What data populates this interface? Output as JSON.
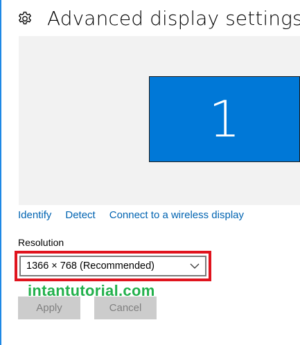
{
  "header": {
    "title": "Advanced display settings",
    "icon": "gear-icon"
  },
  "preview": {
    "monitor_number": "1",
    "monitor_color": "#0078d7"
  },
  "links": {
    "identify": "Identify",
    "detect": "Detect",
    "connect_wireless": "Connect to a wireless display"
  },
  "resolution": {
    "label": "Resolution",
    "selected": "1366 × 768 (Recommended)"
  },
  "watermark": {
    "text": "intantutorial.com",
    "color": "#22b14c"
  },
  "buttons": {
    "apply": "Apply",
    "cancel": "Cancel"
  },
  "colors": {
    "accent": "#0078d7",
    "link": "#0063b1",
    "highlight": "#e0141e"
  }
}
